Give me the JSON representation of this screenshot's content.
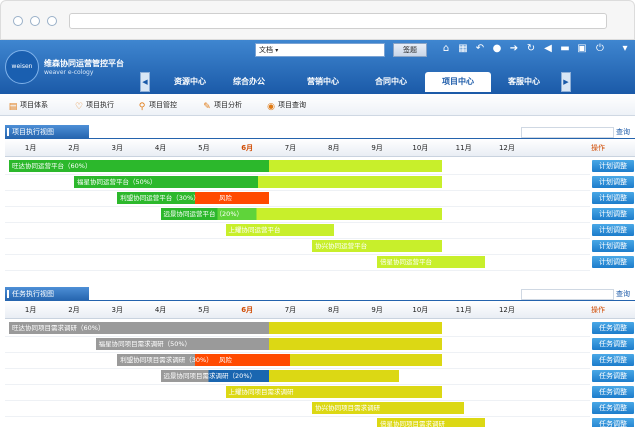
{
  "app": {
    "logo": "weisen",
    "title": "维森协同运营管控平台",
    "subtitle": "weaver e-cology"
  },
  "header": {
    "search_scope": "文档",
    "search_button": "签题",
    "icons": [
      "home-icon",
      "grid-icon",
      "back-icon",
      "user-icon",
      "forward-icon",
      "refresh-icon",
      "tag-icon",
      "expand-icon",
      "lock-icon",
      "power-icon",
      "menu-icon"
    ]
  },
  "tabs": [
    "资源中心",
    "综合办公",
    "营销中心",
    "合同中心",
    "项目中心",
    "客服中心"
  ],
  "active_tab": "项目中心",
  "toolbar": [
    "项目体系",
    "项目执行",
    "项目管控",
    "项目分析",
    "项目查询"
  ],
  "months": [
    "1月",
    "2月",
    "3月",
    "4月",
    "5月",
    "6月",
    "7月",
    "8月",
    "9月",
    "10月",
    "11月",
    "12月"
  ],
  "current_month": "6月",
  "operation_header": "操作",
  "query_link": "查询",
  "colors": {
    "project_done": "#2cb82c",
    "project_done_light": "#5fd43a",
    "project_rest": "#c8ef2b",
    "task_done": "#9a9a9a",
    "task_current": "#1a66b0",
    "task_rest": "#dcd814",
    "risk": "#ff4a00",
    "button": "#1c7ccb"
  },
  "project_panel": {
    "title": "项目执行视图",
    "button_label": "计划调整",
    "rows": [
      {
        "label": "旺达协同运营平台（60%）",
        "start_month": 1.0,
        "end_month": 11.0,
        "progress": 0.6,
        "risk": ""
      },
      {
        "label": "福星协同运营平台（50%）",
        "start_month": 2.5,
        "end_month": 11.0,
        "progress": 0.5,
        "risk": ""
      },
      {
        "label": "利盟协同运营平台（30%）",
        "start_month": 3.5,
        "end_month": 7.0,
        "progress": 0.3,
        "risk": "风险"
      },
      {
        "label": "远景协同运营平台（20%）",
        "start_month": 4.5,
        "end_month": 11.0,
        "progress": 0.2,
        "risk": ""
      },
      {
        "label": "上耀协同运营平台",
        "start_month": 6.0,
        "end_month": 8.5,
        "progress": 0,
        "risk": ""
      },
      {
        "label": "协兴协同运营平台",
        "start_month": 8.0,
        "end_month": 11.0,
        "progress": 0,
        "risk": ""
      },
      {
        "label": "倍星协同运营平台",
        "start_month": 9.5,
        "end_month": 12.0,
        "progress": 0,
        "risk": ""
      }
    ]
  },
  "task_panel": {
    "title": "任务执行视图",
    "button_label": "任务调整",
    "rows": [
      {
        "label": "旺达协同项目需求调研（60%）",
        "start_month": 1.0,
        "end_month": 11.0,
        "progress": 0.6,
        "risk": ""
      },
      {
        "label": "福星协同项目需求调研（50%）",
        "start_month": 3.0,
        "end_month": 11.0,
        "progress": 0.5,
        "risk": ""
      },
      {
        "label": "利盟协同项目需求调研（30%）",
        "start_month": 3.5,
        "end_month": 11.0,
        "progress": 0.3,
        "risk": "风险"
      },
      {
        "label": "远景协同项目需求调研（20%）",
        "start_month": 4.5,
        "end_month": 10.0,
        "progress": 0.2,
        "risk": ""
      },
      {
        "label": "上耀协同项目需求调研",
        "start_month": 6.0,
        "end_month": 11.0,
        "progress": 0,
        "risk": ""
      },
      {
        "label": "协兴协同项目需求调研",
        "start_month": 8.0,
        "end_month": 11.5,
        "progress": 0,
        "risk": ""
      },
      {
        "label": "倍星协同项目需求调研",
        "start_month": 9.5,
        "end_month": 12.0,
        "progress": 0,
        "risk": ""
      }
    ]
  }
}
